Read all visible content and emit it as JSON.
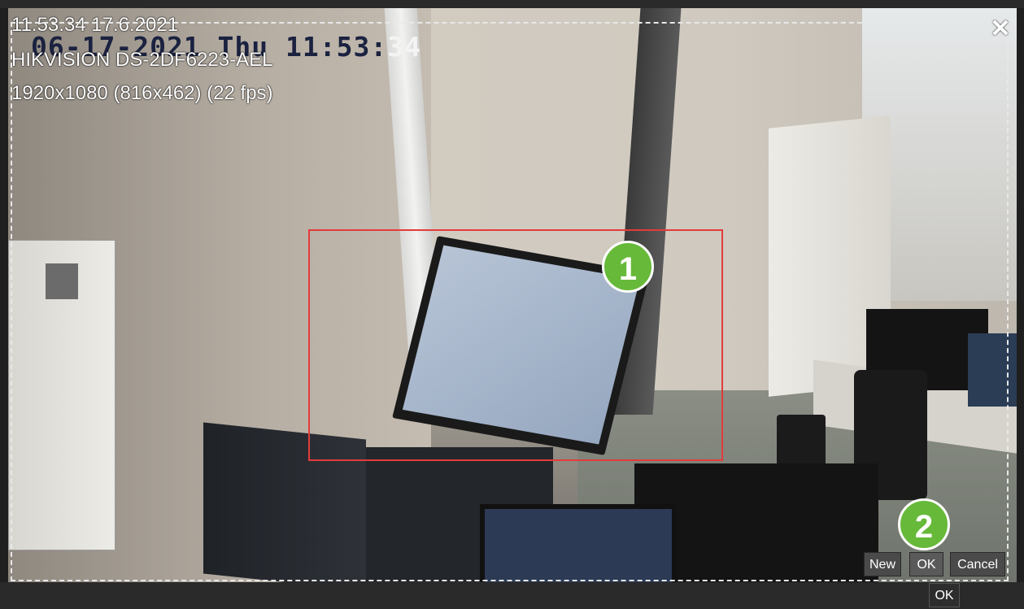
{
  "camera_overlay": {
    "time_date": "11.53.34  17.6.2021",
    "model": "HIKVISION DS-2DF6223-AEL",
    "resolution": "1920x1080 (816x462)  (22 fps)",
    "embedded_timestamp_date": "06-17-2021 Thu 11:53:",
    "embedded_timestamp_seconds": "34"
  },
  "close_button": {
    "icon": "close-icon",
    "glyph": "✕"
  },
  "callouts": {
    "first": "1",
    "second": "2"
  },
  "dialog_buttons": {
    "new_label": "New",
    "ok_label": "OK",
    "cancel_label": "Cancel"
  },
  "footer": {
    "ok_label": "OK"
  },
  "colors": {
    "roi_border": "#e33b3b",
    "callout_badge": "#67b93a",
    "button_bg": "#4a4a4a",
    "background": "#1f1f1f"
  }
}
